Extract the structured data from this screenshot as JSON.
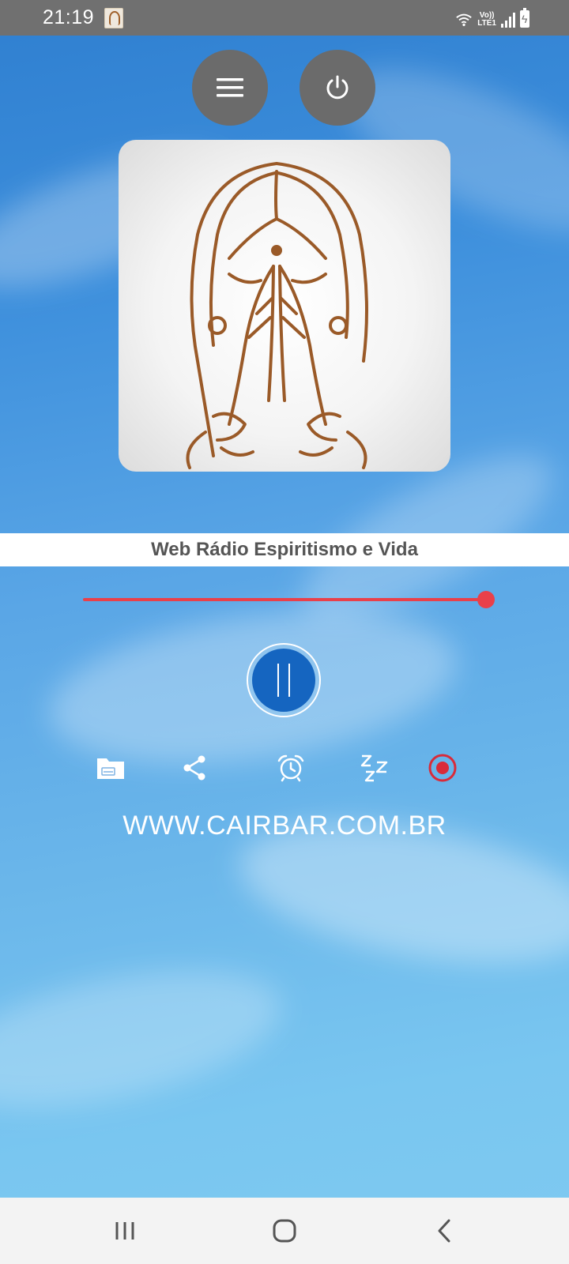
{
  "status_bar": {
    "time": "21:19",
    "icons": [
      "app-notification-icon",
      "wifi-icon",
      "volte-lte-icon",
      "signal-icon",
      "battery-charging-icon"
    ],
    "lte_line1": "Vo))",
    "lte_line2": "LTE1"
  },
  "header": {
    "menu_icon": "menu-icon",
    "power_icon": "power-icon"
  },
  "artwork": {
    "description_icon": "praying-figure-logo"
  },
  "station": {
    "title": "Web Rádio Espiritismo e Vida"
  },
  "player": {
    "volume": 1.0,
    "state_icon": "pause-icon",
    "accent_color": "#e9404a",
    "play_color": "#1565c0"
  },
  "actions": [
    "folder-icon",
    "share-icon",
    "alarm-icon",
    "sleep-icon",
    "record-icon"
  ],
  "footer": {
    "website": "WWW.CAIRBAR.COM.BR"
  },
  "nav": [
    "recent-apps-icon",
    "home-icon",
    "back-icon"
  ]
}
